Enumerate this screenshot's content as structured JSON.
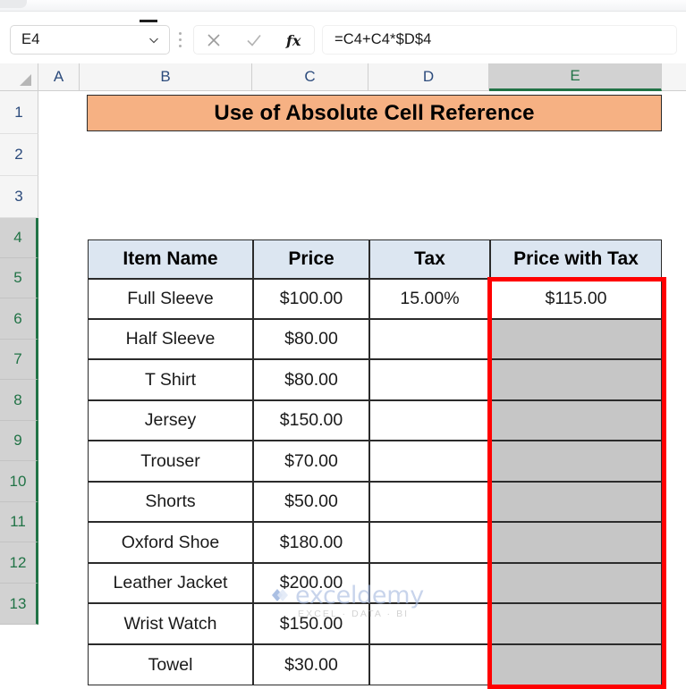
{
  "app": {
    "name_box": {
      "value": "E4",
      "label": "Name Box",
      "caret_icon": "chevron-down-icon"
    },
    "formula_bar": {
      "value": "=C4+C4*$D$4",
      "cancel_icon": "close-icon",
      "confirm_icon": "check-icon",
      "function_icon": "fx-icon",
      "options_icon": "kebab-menu-icon"
    }
  },
  "grid": {
    "select_all_icon": "select-all-corner-icon",
    "columns": [
      {
        "label": "A",
        "selected": false
      },
      {
        "label": "B",
        "selected": false
      },
      {
        "label": "C",
        "selected": false
      },
      {
        "label": "D",
        "selected": false
      },
      {
        "label": "E",
        "selected": true
      }
    ],
    "rows": [
      {
        "label": "1",
        "selected": false
      },
      {
        "label": "2",
        "selected": false
      },
      {
        "label": "3",
        "selected": false
      },
      {
        "label": "4",
        "selected": true
      },
      {
        "label": "5",
        "selected": true
      },
      {
        "label": "6",
        "selected": true
      },
      {
        "label": "7",
        "selected": true
      },
      {
        "label": "8",
        "selected": true
      },
      {
        "label": "9",
        "selected": true
      },
      {
        "label": "10",
        "selected": true
      },
      {
        "label": "11",
        "selected": true
      },
      {
        "label": "12",
        "selected": true
      },
      {
        "label": "13",
        "selected": true
      }
    ]
  },
  "sheet": {
    "title": "Use of Absolute Cell Reference",
    "title_bg": "#f6b183",
    "header_bg": "#dce6f1",
    "selection_fill": "#c6c6c6",
    "annotation_color": "#ff0000",
    "selected_header_color": "#217346",
    "table": {
      "headers": [
        "Item Name",
        "Price",
        "Tax",
        "Price with Tax"
      ],
      "rows": [
        {
          "item": "Full Sleeve",
          "price": "$100.00",
          "tax": "15.00%",
          "price_with_tax": "$115.00"
        },
        {
          "item": "Half Sleeve",
          "price": "$80.00",
          "tax": "",
          "price_with_tax": ""
        },
        {
          "item": "T Shirt",
          "price": "$80.00",
          "tax": "",
          "price_with_tax": ""
        },
        {
          "item": "Jersey",
          "price": "$150.00",
          "tax": "",
          "price_with_tax": ""
        },
        {
          "item": "Trouser",
          "price": "$70.00",
          "tax": "",
          "price_with_tax": ""
        },
        {
          "item": "Shorts",
          "price": "$50.00",
          "tax": "",
          "price_with_tax": ""
        },
        {
          "item": "Oxford Shoe",
          "price": "$180.00",
          "tax": "",
          "price_with_tax": ""
        },
        {
          "item": "Leather Jacket",
          "price": "$200.00",
          "tax": "",
          "price_with_tax": ""
        },
        {
          "item": "Wrist Watch",
          "price": "$150.00",
          "tax": "",
          "price_with_tax": ""
        },
        {
          "item": "Towel",
          "price": "$30.00",
          "tax": "",
          "price_with_tax": ""
        }
      ]
    }
  },
  "watermark": {
    "brand": "exceldemy",
    "tagline": "EXCEL · DATA · BI"
  }
}
